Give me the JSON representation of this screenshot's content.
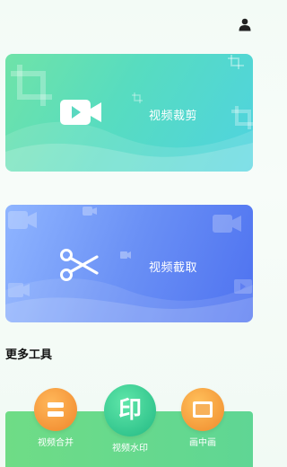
{
  "header": {
    "user_icon": "user-icon"
  },
  "cards": [
    {
      "label": "视频裁剪",
      "icon": "video-camera-icon",
      "colors": [
        "#6fe3a8",
        "#4fd3e0"
      ]
    },
    {
      "label": "视频截取",
      "icon": "scissors-icon",
      "colors": [
        "#8fb5ff",
        "#4e72f0"
      ]
    }
  ],
  "more_tools": {
    "title": "更多工具",
    "items": [
      {
        "label": "视频合并",
        "icon": "merge-icon",
        "color": "#f39a3a"
      },
      {
        "label": "视频水印",
        "icon": "watermark-icon",
        "glyph": "印",
        "color": "#3ecf95"
      },
      {
        "label": "画中画",
        "icon": "picture-in-picture-icon",
        "color": "#f5a33a"
      }
    ]
  }
}
